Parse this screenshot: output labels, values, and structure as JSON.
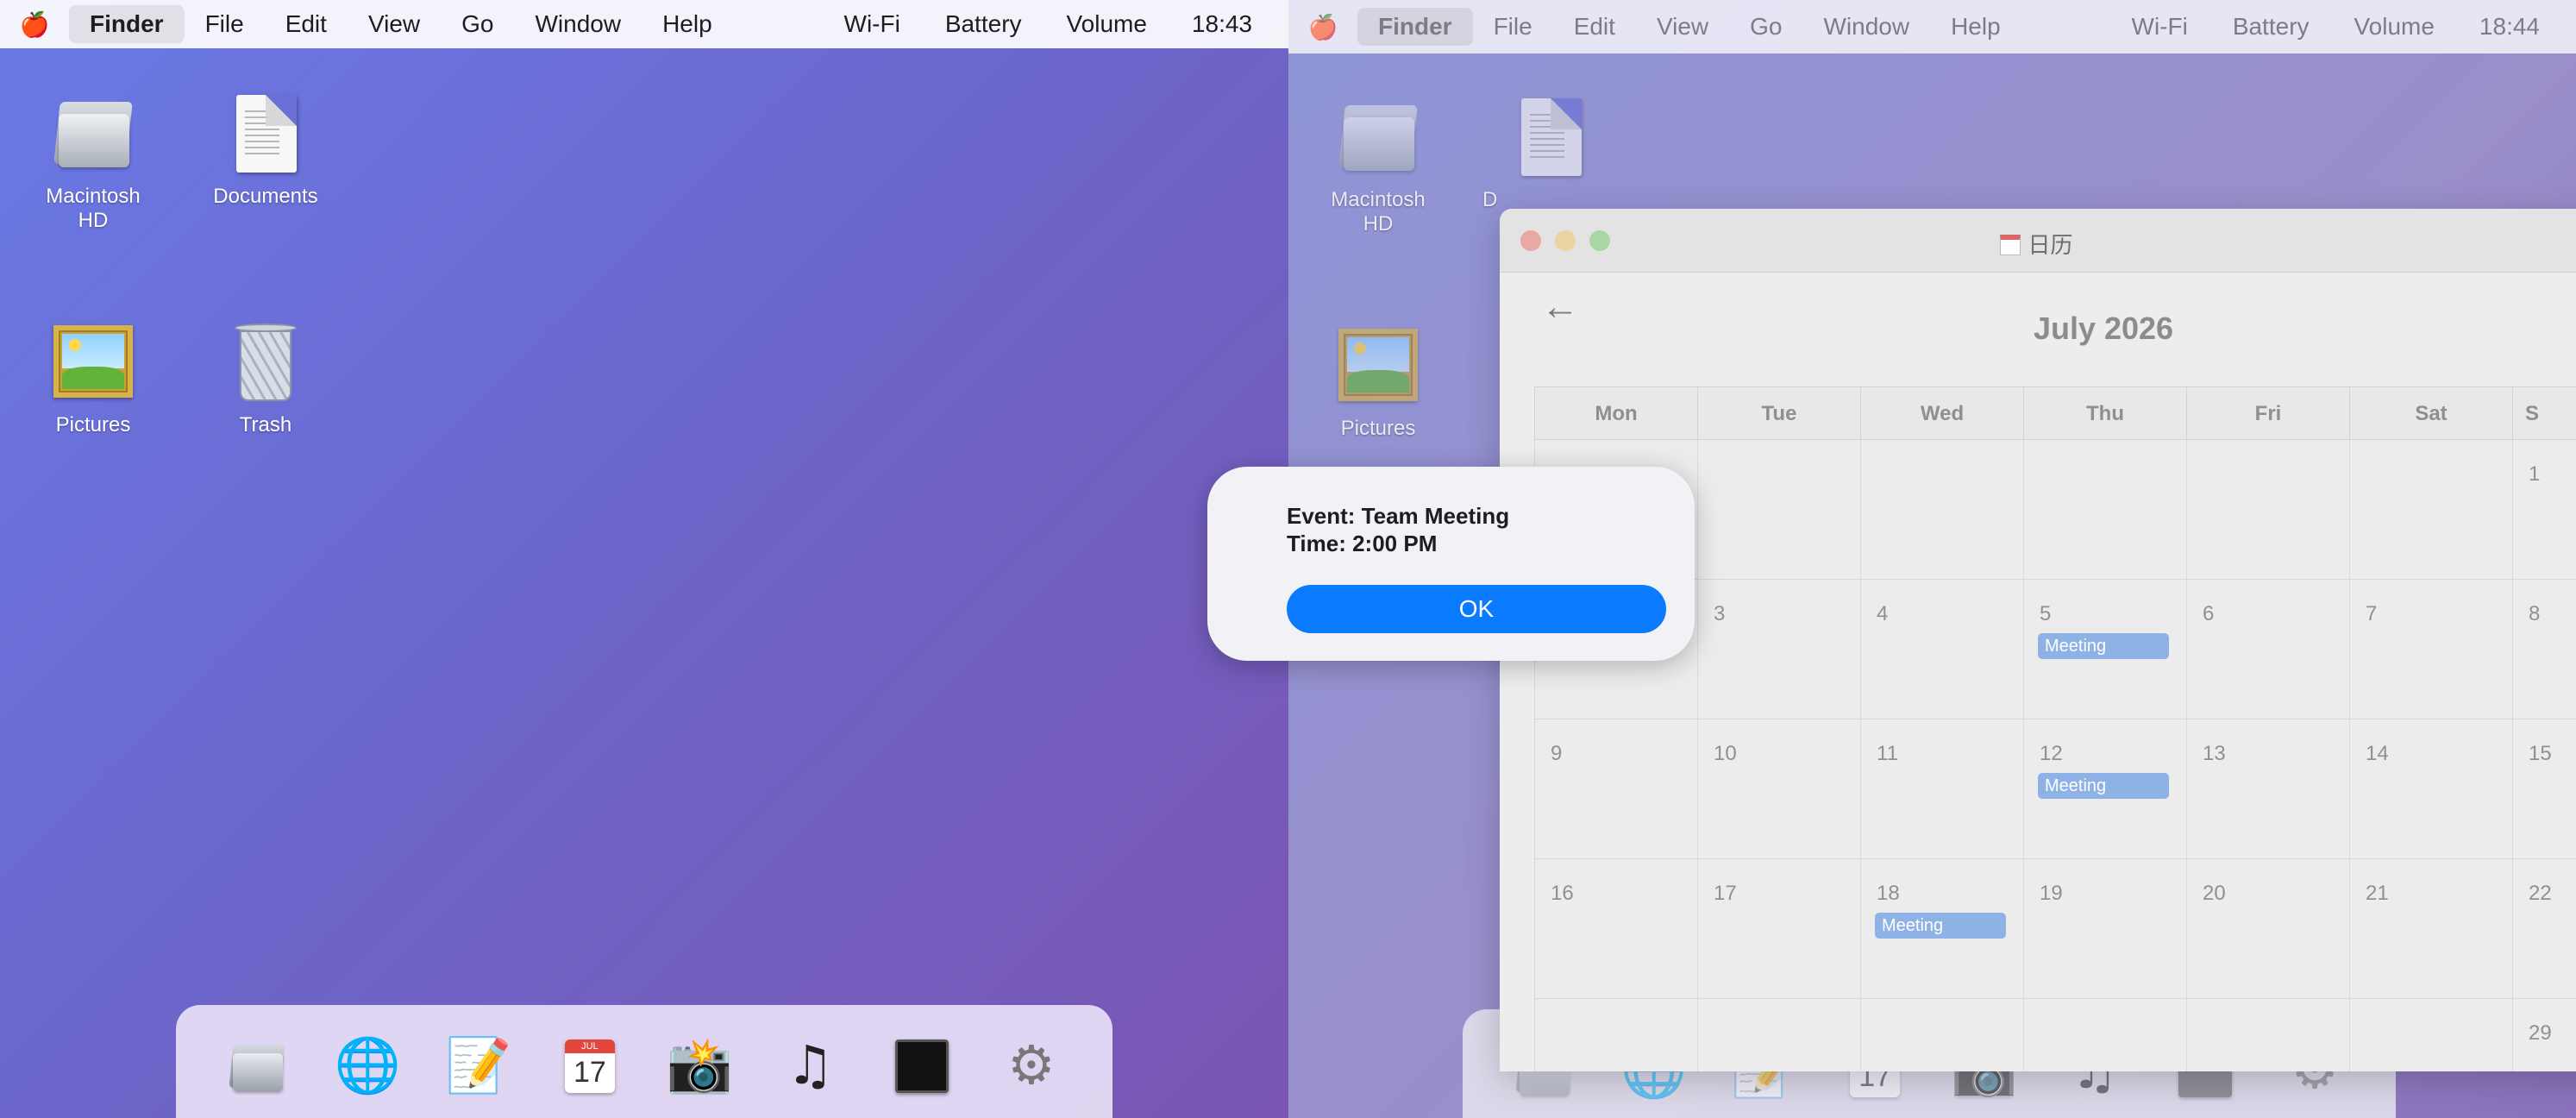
{
  "left": {
    "menubar": {
      "apple_icon": "🍎",
      "app_name": "Finder",
      "menus": [
        "File",
        "Edit",
        "View",
        "Go",
        "Window",
        "Help"
      ],
      "status": [
        "Wi-Fi",
        "Battery",
        "Volume"
      ],
      "clock": "18:43"
    },
    "desktop_icons": [
      "Macintosh\nHD",
      "Documents",
      "Pictures",
      "Trash"
    ],
    "dock_icons": [
      "folder-icon",
      "globe-icon",
      "notes-icon",
      "calendar-icon",
      "camera-icon",
      "music-icon",
      "terminal-icon",
      "settings-icon"
    ]
  },
  "right": {
    "menubar": {
      "apple_icon": "🍎",
      "app_name": "Finder",
      "menus": [
        "File",
        "Edit",
        "View",
        "Go",
        "Window",
        "Help"
      ],
      "status": [
        "Wi-Fi",
        "Battery",
        "Volume"
      ],
      "clock": "18:44"
    },
    "desktop_icons": [
      "Macintosh\nHD",
      "Pictures"
    ],
    "doc_label_fragment": "D",
    "calendar": {
      "window_title": "日历",
      "prev_arrow": "←",
      "month_title": "July 2026",
      "weekdays": [
        "Mon",
        "Tue",
        "Wed",
        "Thu",
        "Fri",
        "Sat",
        "S"
      ],
      "weeks": [
        [
          "",
          "",
          "",
          "",
          "",
          "",
          "1"
        ],
        [
          "",
          "3",
          "4",
          "5",
          "6",
          "7",
          "8"
        ],
        [
          "9",
          "10",
          "11",
          "12",
          "13",
          "14",
          "15"
        ],
        [
          "16",
          "17",
          "18",
          "19",
          "20",
          "21",
          "22"
        ],
        [
          "",
          "",
          "",
          "",
          "",
          "",
          "29"
        ]
      ],
      "events": [
        {
          "day": "5",
          "label": "Meeting"
        },
        {
          "day": "12",
          "label": "Meeting"
        },
        {
          "day": "18",
          "label": "Meeting"
        }
      ],
      "calendar_dock_date": "17",
      "calendar_dock_month": "JUL"
    },
    "alert": {
      "event_line": "Event: Team Meeting",
      "time_line": "Time: 2:00 PM",
      "ok_label": "OK"
    }
  }
}
